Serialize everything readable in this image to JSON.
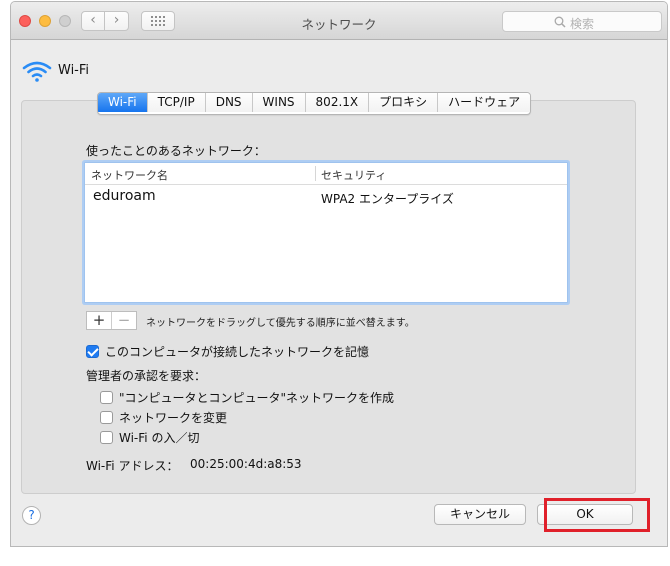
{
  "window": {
    "title": "ネットワーク"
  },
  "search": {
    "placeholder": "検索"
  },
  "header": {
    "title": "Wi-Fi"
  },
  "tabs": [
    {
      "label": "Wi-Fi",
      "active": true
    },
    {
      "label": "TCP/IP",
      "active": false
    },
    {
      "label": "DNS",
      "active": false
    },
    {
      "label": "WINS",
      "active": false
    },
    {
      "label": "802.1X",
      "active": false
    },
    {
      "label": "プロキシ",
      "active": false
    },
    {
      "label": "ハードウェア",
      "active": false
    }
  ],
  "networks": {
    "label": "使ったことのあるネットワーク：",
    "columns": {
      "name": "ネットワーク名",
      "security": "セキュリティ"
    },
    "rows": [
      {
        "name": "eduroam",
        "security": "WPA2 エンタープライズ"
      }
    ],
    "add_symbol": "+",
    "remove_symbol": "−",
    "hint": "ネットワークをドラッグして優先する順序に並べ替えます。"
  },
  "options": {
    "remember": {
      "label": "このコンピュータが接続したネットワークを記憶",
      "checked": true
    },
    "admin_label": "管理者の承認を要求：",
    "admin_items": [
      {
        "label": "\"コンピュータとコンピュータ\"ネットワークを作成",
        "checked": false
      },
      {
        "label": "ネットワークを変更",
        "checked": false
      },
      {
        "label": "Wi-Fi の入／切",
        "checked": false
      }
    ]
  },
  "mac": {
    "label": "Wi-Fi アドレス：",
    "value": "00:25:00:4d:a8:53"
  },
  "footer": {
    "help": "?",
    "cancel": "キャンセル",
    "ok": "OK"
  },
  "colors": {
    "accent": "#1674ee",
    "highlight": "#e0202a"
  }
}
